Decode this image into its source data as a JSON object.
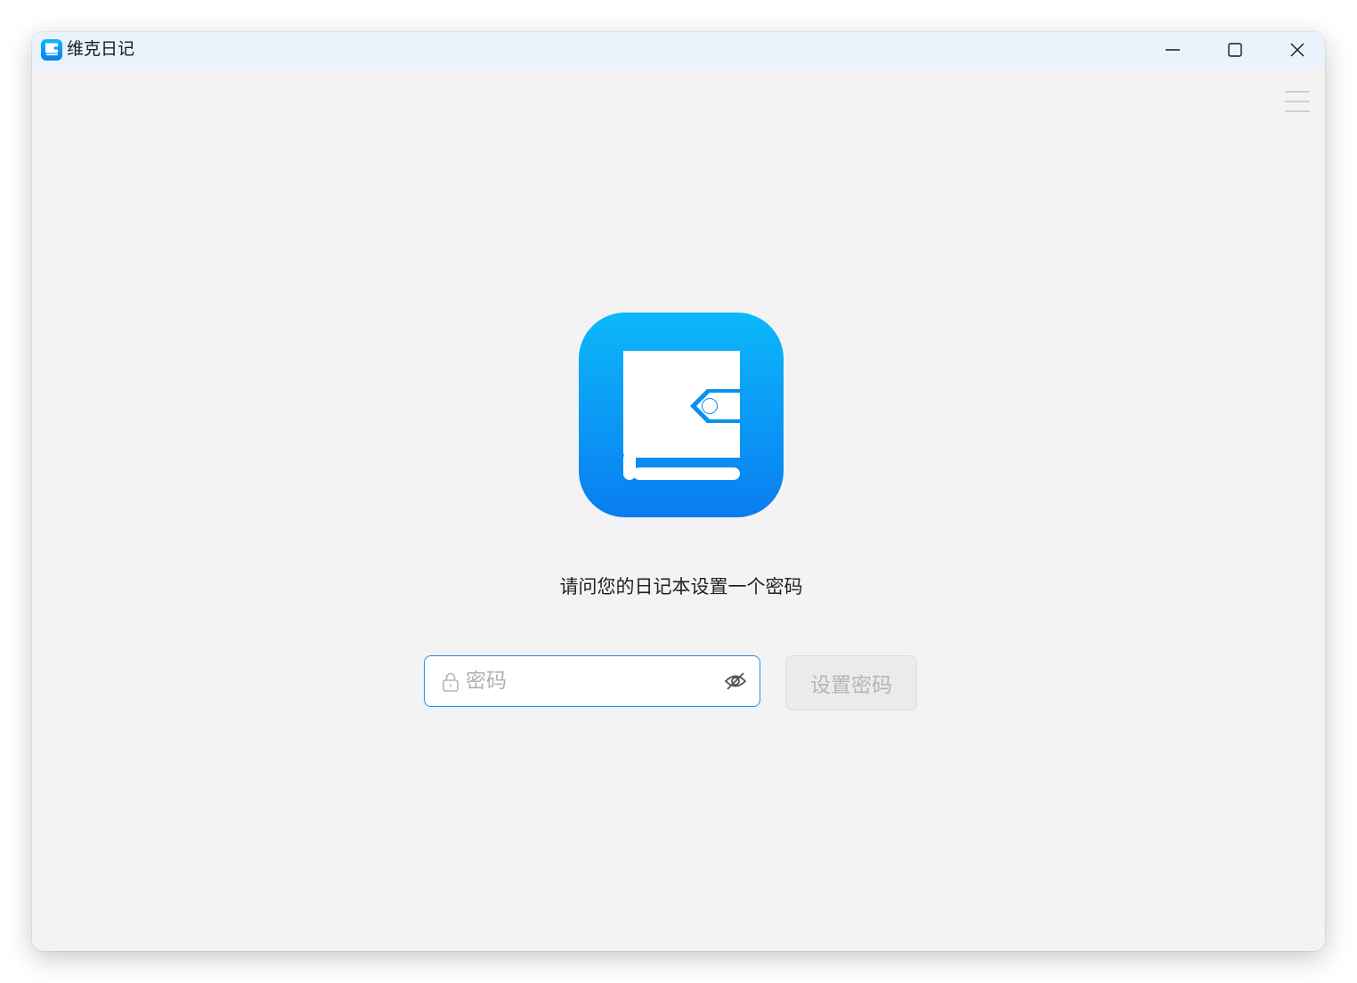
{
  "window": {
    "title": "维克日记",
    "controls": [
      "minimize-icon",
      "maximize-icon",
      "close-icon"
    ]
  },
  "menu": {
    "icon": "hamburger-menu-icon"
  },
  "logo": {
    "icon": "diary-book-icon",
    "colors": {
      "gradient_top": "#0cb8fa",
      "gradient_bottom": "#0a7df0"
    }
  },
  "setup": {
    "prompt": "请问您的日记本设置一个密码",
    "password_placeholder": "密码",
    "password_value": "",
    "lock_icon": "lock-icon",
    "visibility_icon": "eye-off-icon",
    "submit_label": "设置密码",
    "submit_enabled": false
  },
  "colors": {
    "accent": "#1e90f0",
    "window_bg": "#f3f3f3",
    "titlebar_bg": "#eaf2fb"
  }
}
